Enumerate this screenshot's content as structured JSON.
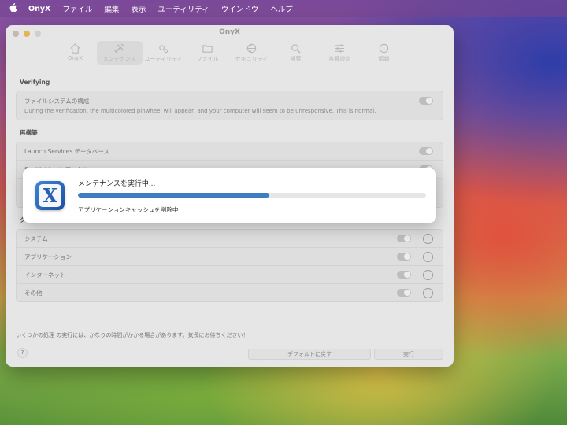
{
  "menubar": {
    "apple": "",
    "app": "OnyX",
    "items": [
      "ファイル",
      "編集",
      "表示",
      "ユーティリティ",
      "ウインドウ",
      "ヘルプ"
    ]
  },
  "window": {
    "title": "OnyX",
    "toolbar": [
      "OnyX",
      "メンテナンス",
      "ユーティリティ",
      "ファイル",
      "セキュリティ",
      "検索",
      "各種設定",
      "情報"
    ],
    "active_tab": "メンテナンス"
  },
  "sections": {
    "verifying": {
      "title": "Verifying",
      "row_label": "ファイルシステムの構成",
      "row_desc": "During the verification, the multicolored pinwheel will appear, and your computer will seem to be unresponsive. This is normal."
    },
    "rebuild": {
      "title": "再構築",
      "rows": [
        "Launch Services データベース",
        "Spotlight インデックス"
      ]
    },
    "cleaning": {
      "title": "クリーニング",
      "rows": [
        "システム",
        "アプリケーション",
        "インターネット",
        "その他"
      ]
    }
  },
  "footer": {
    "note": "いくつかの処理 の実行には、かなりの時間がかかる場合があります。気長にお待ちください！",
    "help": "?",
    "default_button": "デフォルトに戻す",
    "run_button": "実行"
  },
  "dialog": {
    "title": "メンテナンスを実行中...",
    "status": "アプリケーションキャッシュを削除中",
    "progress": 0.55,
    "icon_letter": "X"
  },
  "colors": {
    "accent": "#3e7dc4",
    "window_bg": "#e7e6e6"
  }
}
